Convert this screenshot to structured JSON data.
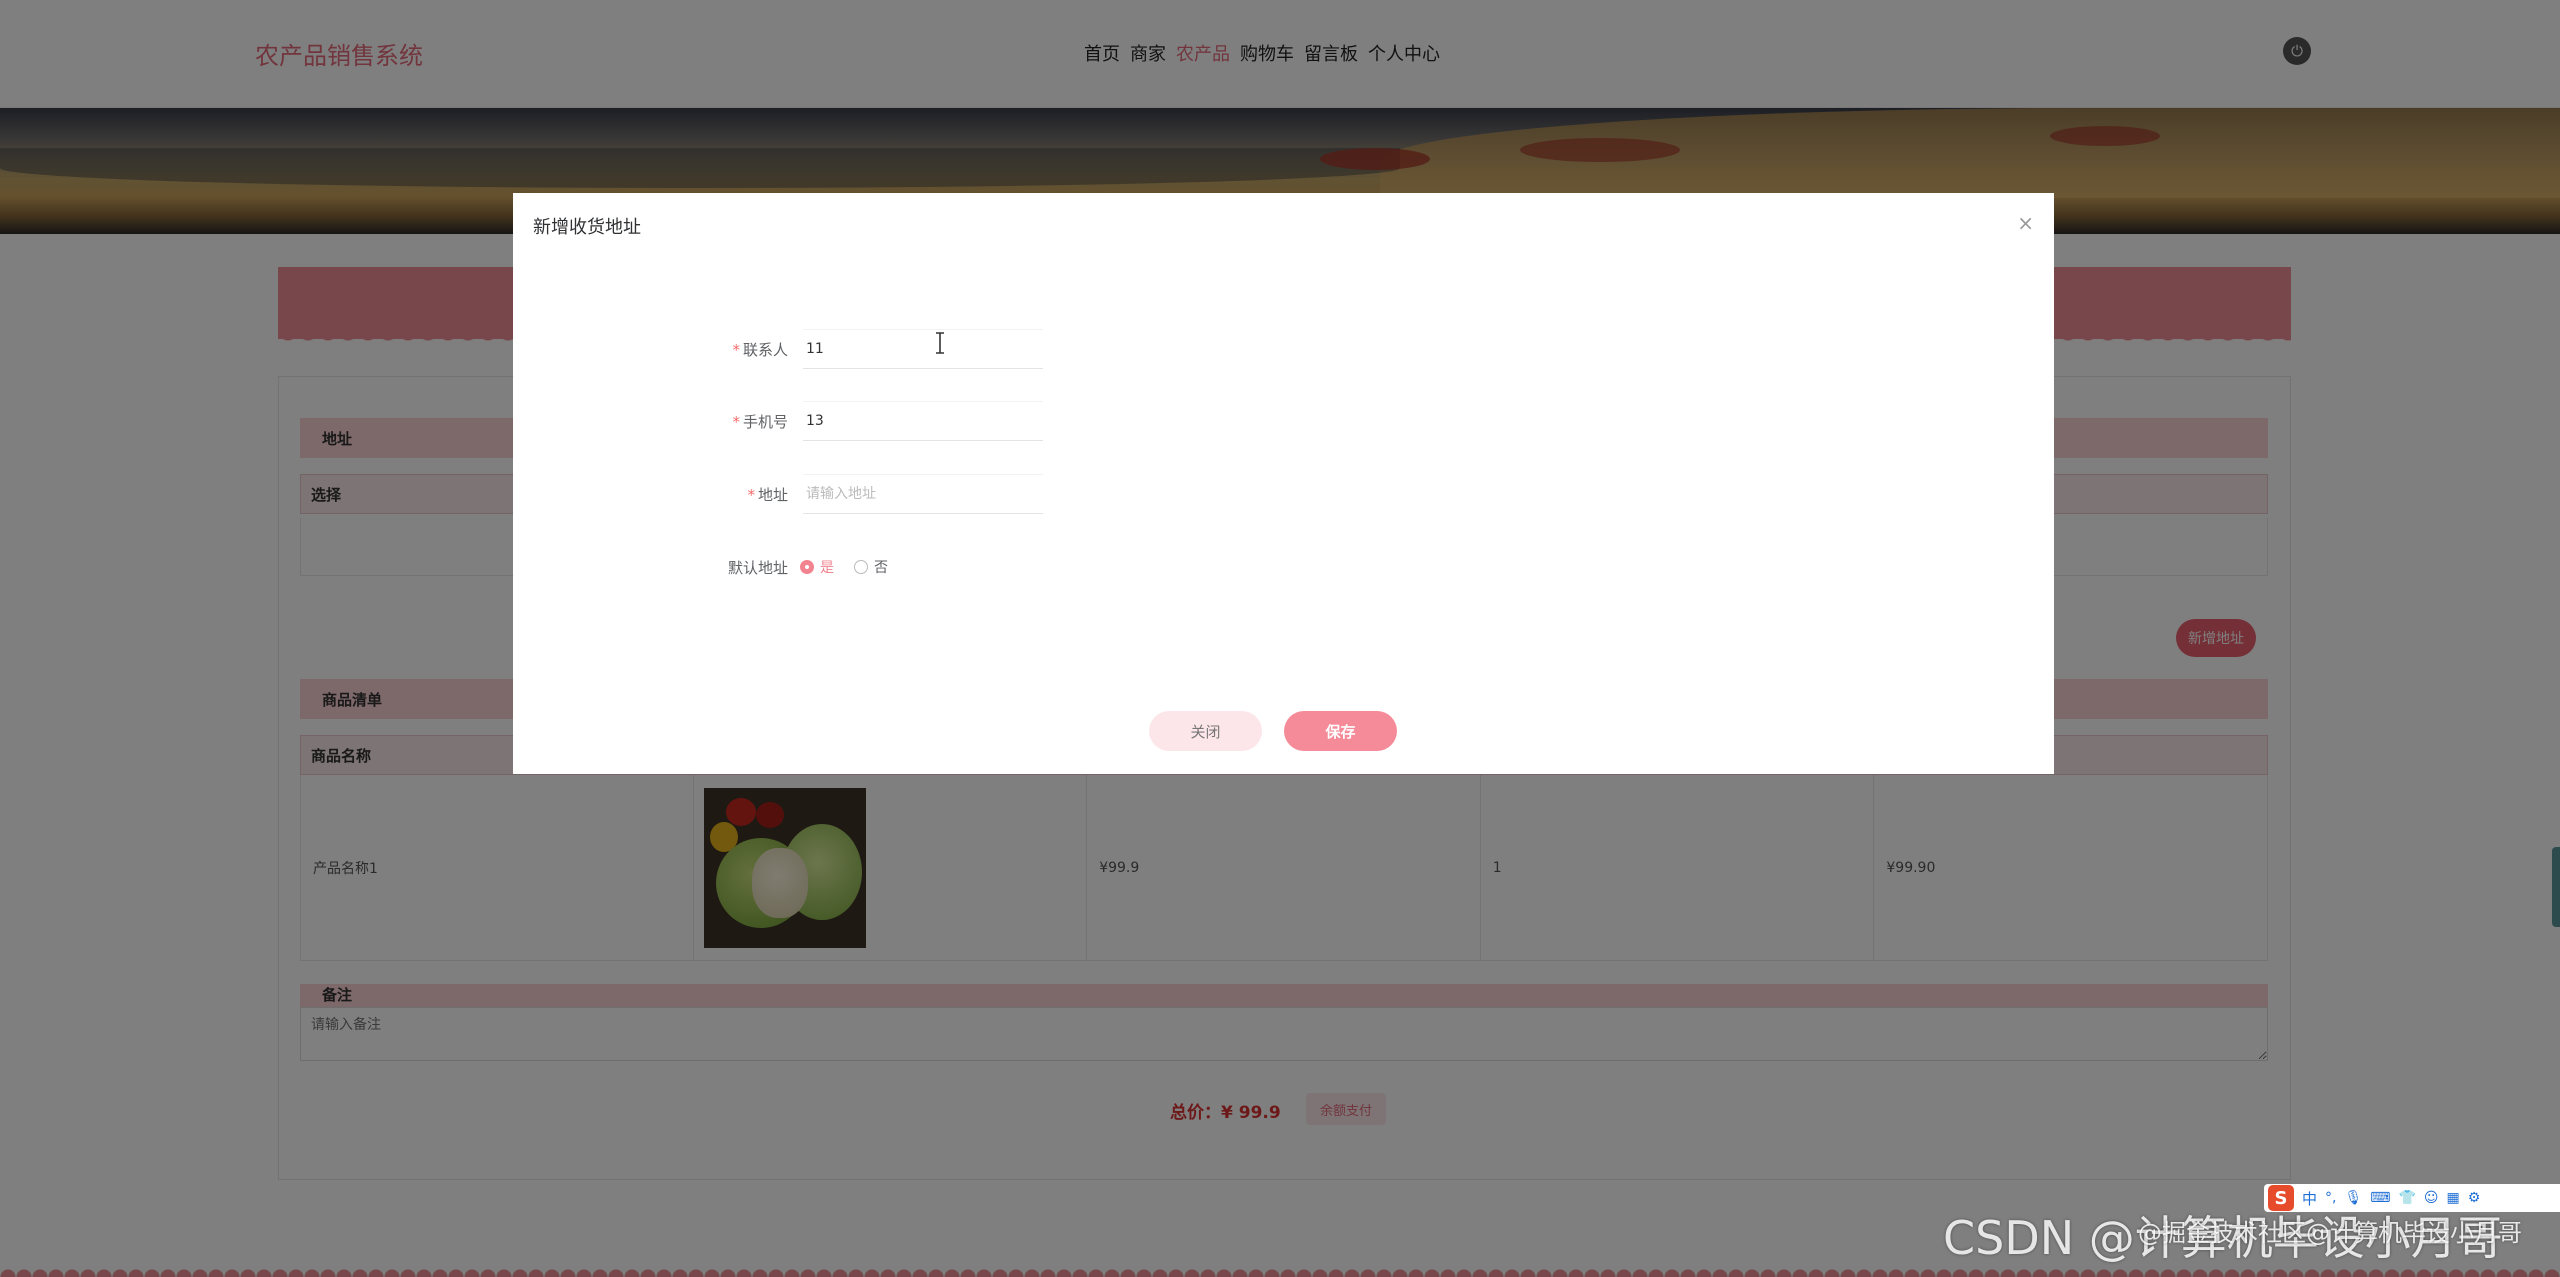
{
  "header": {
    "logo": "农产品销售系统",
    "nav": [
      {
        "label": "首页",
        "active": false
      },
      {
        "label": "商家",
        "active": false
      },
      {
        "label": "农产品",
        "active": true
      },
      {
        "label": "购物车",
        "active": false
      },
      {
        "label": "留言板",
        "active": false
      },
      {
        "label": "个人中心",
        "active": false
      }
    ],
    "power_icon": "power-icon"
  },
  "page": {
    "address_section": "地址",
    "address_col_select": "选择",
    "add_address_button": "新增地址",
    "goods_section": "商品清单",
    "goods_col_name": "商品名称",
    "goods_row": {
      "name": "产品名称1",
      "price": "¥99.9",
      "quantity": "1",
      "subtotal": "¥99.90"
    },
    "remark_section": "备注",
    "remark_placeholder": "请输入备注",
    "total_label": "总价：",
    "total_value": "¥ 99.9",
    "pay_button": "余额支付"
  },
  "modal": {
    "title": "新增收货地址",
    "close_icon": "close-icon",
    "fields": {
      "contact": {
        "label": "联系人",
        "value": "11"
      },
      "phone": {
        "label": "手机号",
        "value": "13"
      },
      "address": {
        "label": "地址",
        "value": "",
        "placeholder": "请输入地址"
      },
      "default": {
        "label": "默认地址",
        "options": [
          "是",
          "否"
        ],
        "selected": "是"
      }
    },
    "cancel_button": "关闭",
    "save_button": "保存"
  },
  "ime": {
    "logo": "S",
    "lang": "中",
    "icons": [
      "punctuation-icon",
      "mic-icon",
      "keyboard-icon",
      "skin-icon",
      "robot-icon",
      "grid-icon",
      "gear-icon"
    ]
  },
  "watermark": {
    "text": "CSDN @计算机毕设小月哥",
    "overlay_text": "@掘金技术社区@计算机毕设小月哥"
  },
  "colors": {
    "accent": "#e46b7b",
    "primary_button": "#f58a98",
    "section_bar": "#fbd0d5"
  }
}
